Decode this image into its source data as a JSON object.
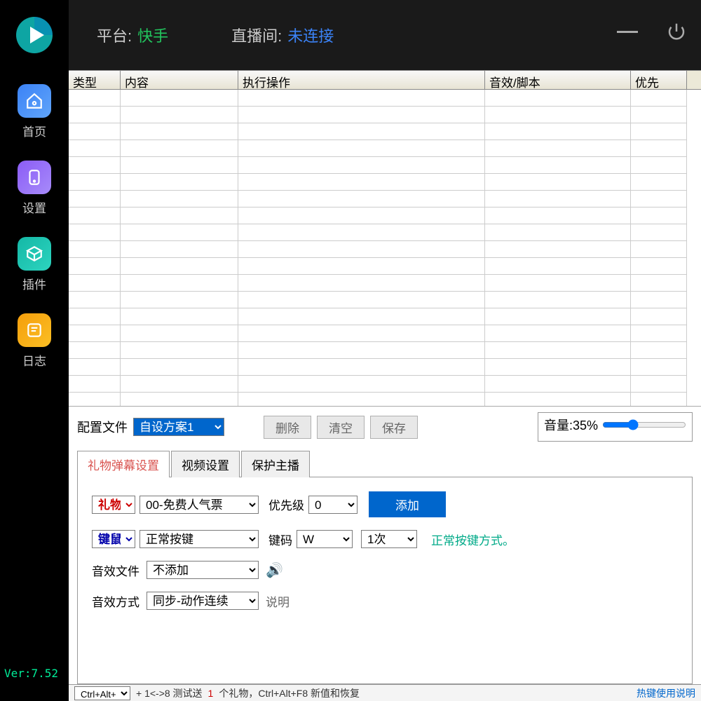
{
  "sidebar": {
    "items": [
      {
        "label": "首页"
      },
      {
        "label": "设置"
      },
      {
        "label": "插件"
      },
      {
        "label": "日志"
      }
    ],
    "version": "Ver:7.52"
  },
  "topbar": {
    "platform_label": "平台:",
    "platform_value": "快手",
    "room_label": "直播间:",
    "room_value": "未连接"
  },
  "table": {
    "headers": [
      "类型",
      "内容",
      "执行操作",
      "音效/脚本",
      "优先"
    ]
  },
  "config": {
    "label": "配置文件",
    "selected": "自设方案1",
    "buttons": {
      "delete": "删除",
      "clear": "清空",
      "save": "保存"
    },
    "volume_label": "音量:35%",
    "volume_value": 35
  },
  "tabs": {
    "t1": "礼物弹幕设置",
    "t2": "视频设置",
    "t3": "保护主播"
  },
  "form": {
    "gift_label": "礼物",
    "gift_item": "00-免费人气票",
    "priority_label": "优先级",
    "priority_value": "0",
    "add": "添加",
    "kbm_label": "键鼠",
    "kbm_mode": "正常按键",
    "keycode_label": "键码",
    "keycode_value": "W",
    "count": "1次",
    "hint": "正常按键方式。",
    "sound_label": "音效文件",
    "sound_value": "不添加",
    "method_label": "音效方式",
    "method_value": "同步-动作连续",
    "explain": "说明"
  },
  "footer": {
    "a": "Ctrl+Alt+",
    "b": "+ 1<->8 测试送",
    "c": "1",
    "d": "个礼物，Ctrl+Alt+F8 新值和恢复",
    "link": "热键使用说明"
  }
}
